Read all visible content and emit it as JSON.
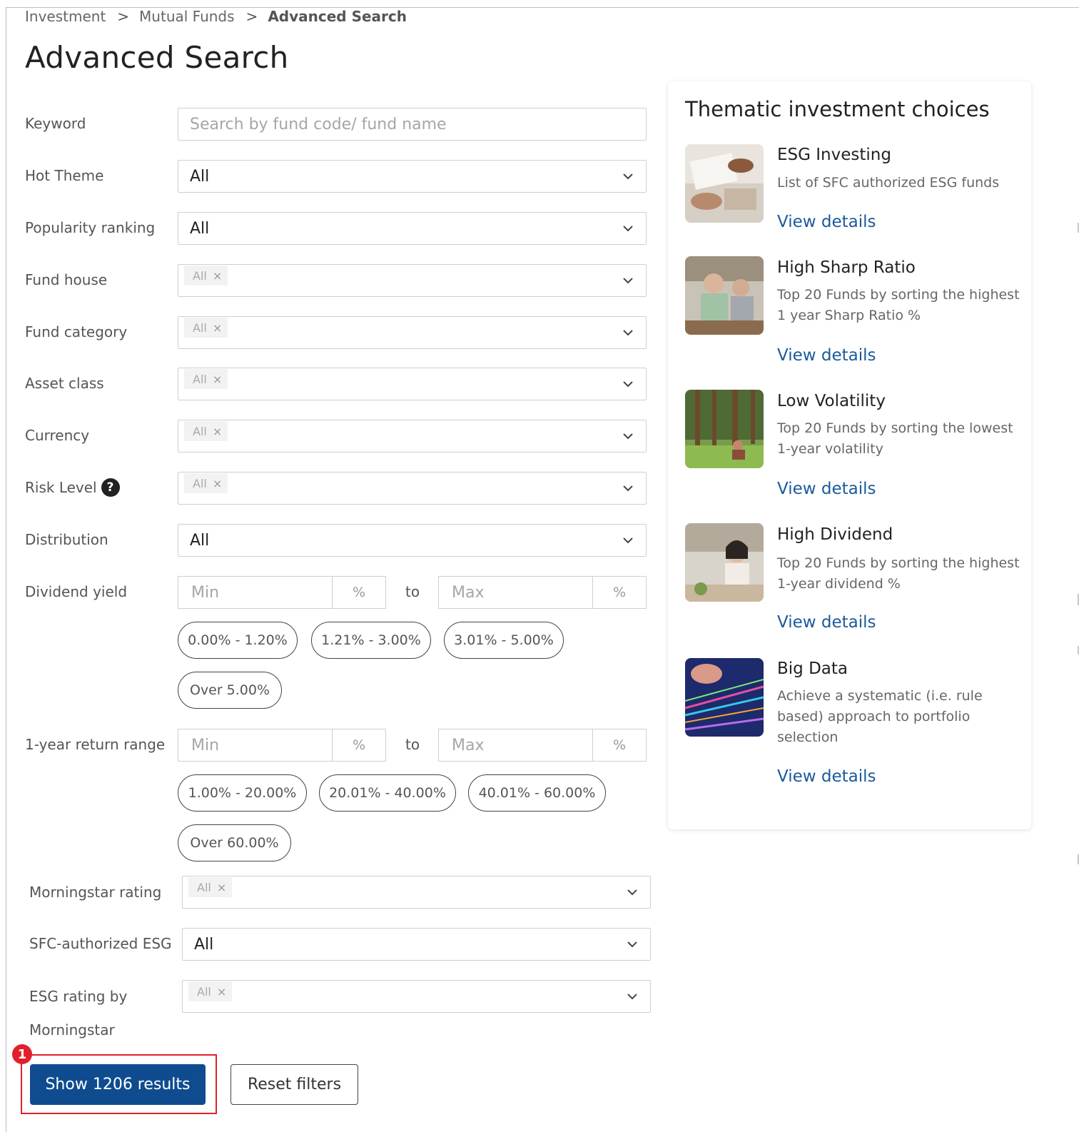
{
  "breadcrumb": {
    "items": [
      "Investment",
      "Mutual Funds"
    ],
    "current": "Advanced Search",
    "separator": ">"
  },
  "page_title": "Advanced Search",
  "form": {
    "keyword": {
      "label": "Keyword",
      "placeholder": "Search by fund code/ fund name"
    },
    "hot_theme": {
      "label": "Hot Theme",
      "value": "All"
    },
    "popularity_ranking": {
      "label": "Popularity ranking",
      "value": "All"
    },
    "fund_house": {
      "label": "Fund house",
      "chip": "All"
    },
    "fund_category": {
      "label": "Fund category",
      "chip": "All"
    },
    "asset_class": {
      "label": "Asset class",
      "chip": "All"
    },
    "currency": {
      "label": "Currency",
      "chip": "All"
    },
    "risk_level": {
      "label": "Risk Level",
      "help": "?",
      "chip": "All"
    },
    "distribution": {
      "label": "Distribution",
      "value": "All"
    },
    "dividend_yield": {
      "label": "Dividend yield",
      "min_placeholder": "Min",
      "max_placeholder": "Max",
      "unit": "%",
      "to": "to",
      "presets": [
        "0.00% - 1.20%",
        "1.21% - 3.00%",
        "3.01% - 5.00%",
        "Over 5.00%"
      ]
    },
    "one_year_return": {
      "label": "1-year return range",
      "min_placeholder": "Min",
      "max_placeholder": "Max",
      "unit": "%",
      "to": "to",
      "presets": [
        "1.00% - 20.00%",
        "20.01% - 40.00%",
        "40.01% - 60.00%",
        "Over 60.00%"
      ]
    },
    "morningstar_rating": {
      "label": "Morningstar rating",
      "chip": "All"
    },
    "sfc_esg": {
      "label": "SFC-authorized ESG",
      "value": "All"
    },
    "esg_rating": {
      "label_line1": "ESG rating by",
      "label_line2": "Morningstar",
      "chip": "All"
    },
    "chip_remove": "×"
  },
  "actions": {
    "show_results": "Show 1206 results",
    "reset_filters": "Reset filters",
    "step_marker": "1"
  },
  "panel": {
    "title": "Thematic investment choices",
    "themes": [
      {
        "name": "ESG Investing",
        "desc": "List of SFC authorized ESG funds",
        "link": "View details"
      },
      {
        "name": "High Sharp Ratio",
        "desc": "Top 20 Funds by sorting the highest 1 year Sharp Ratio %",
        "link": "View details"
      },
      {
        "name": "Low Volatility",
        "desc": "Top 20 Funds by sorting the lowest 1-year volatility",
        "link": "View details"
      },
      {
        "name": "High Dividend",
        "desc": "Top 20 Funds by sorting the highest 1-year dividend %",
        "link": "View details"
      },
      {
        "name": "Big Data",
        "desc": "Achieve a systematic (i.e. rule based) approach to portfolio selection",
        "link": "View details"
      }
    ]
  },
  "colors": {
    "primary": "#0f4c8f",
    "link": "#1b5a9c",
    "highlight": "#e0212b"
  }
}
